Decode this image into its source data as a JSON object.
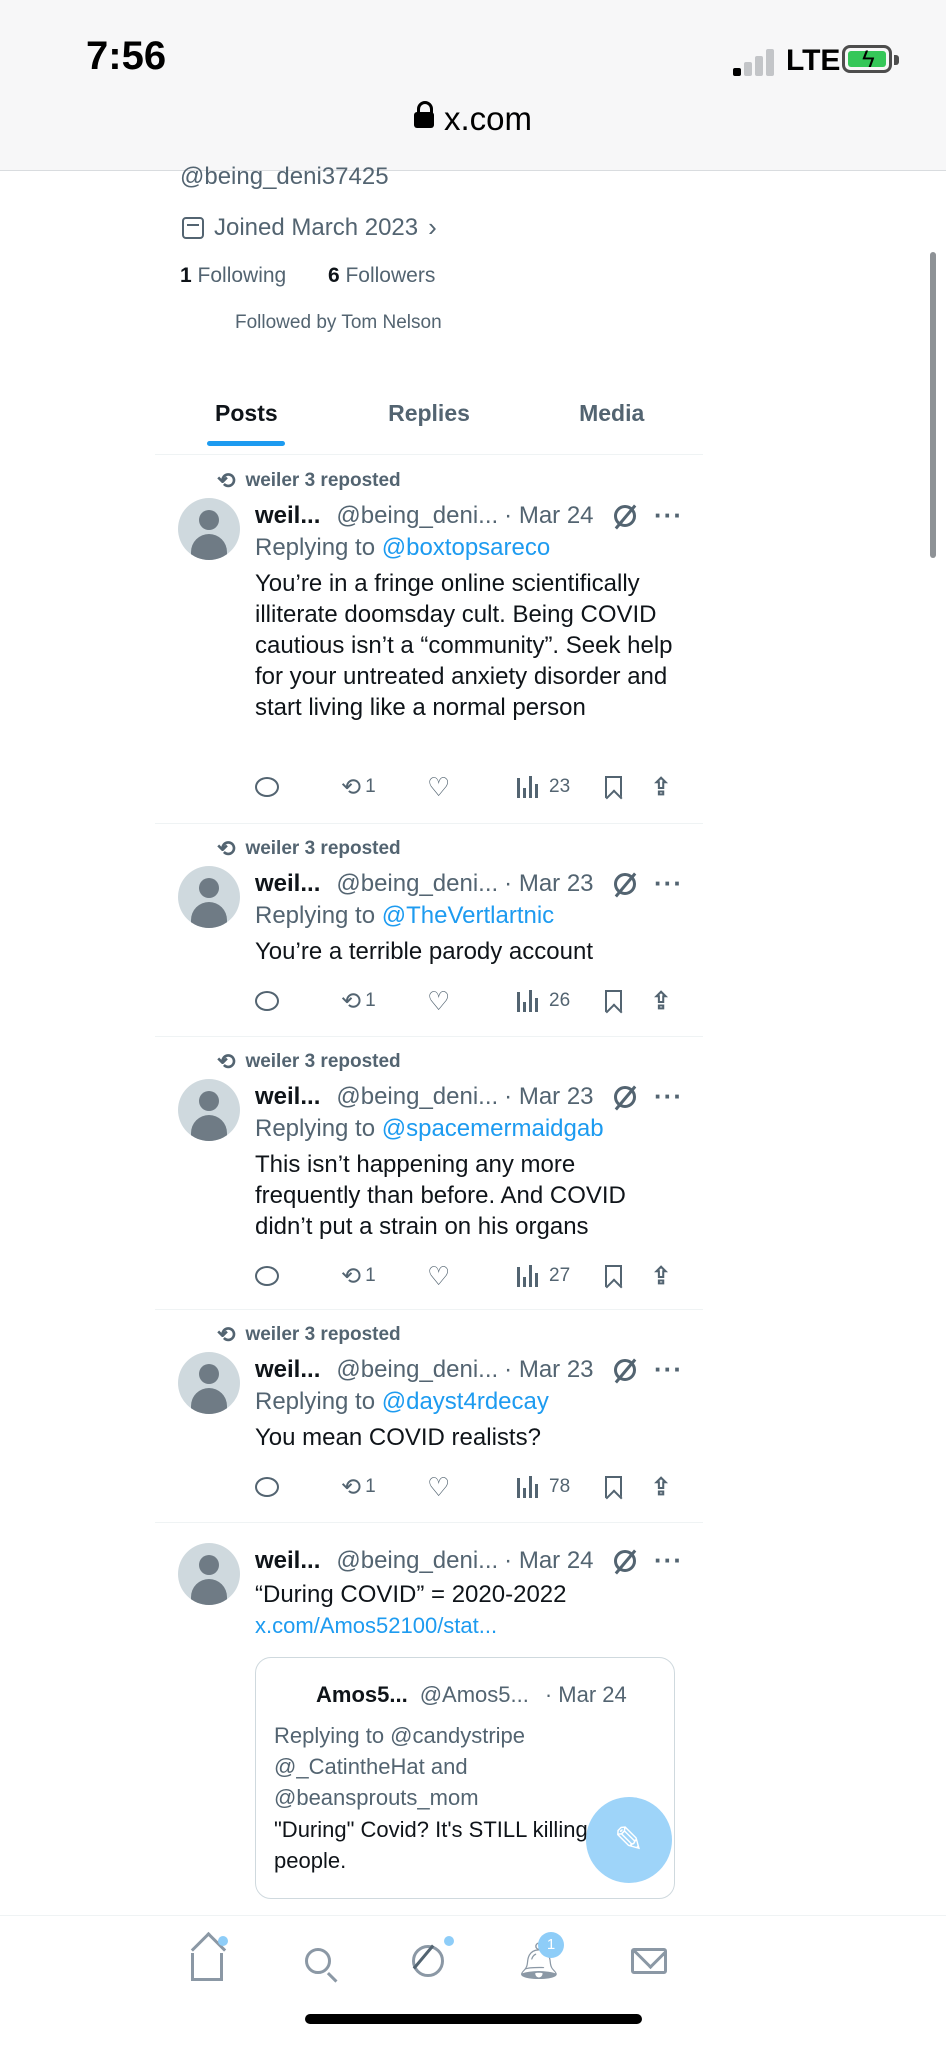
{
  "status_bar": {
    "time": "7:56",
    "network": "LTE",
    "url": "x.com"
  },
  "profile": {
    "handle": "@being_deni37425",
    "joined": "Joined March 2023",
    "following_count": "1",
    "following_label": "Following",
    "followers_count": "6",
    "followers_label": "Followers",
    "followed_by": "Followed by Tom Nelson"
  },
  "tabs": [
    {
      "label": "Posts",
      "active": true
    },
    {
      "label": "Replies",
      "active": false
    },
    {
      "label": "Media",
      "active": false
    }
  ],
  "posts": [
    {
      "repost_label": "weiler 3 reposted",
      "name": "weil...",
      "handle": "@being_deni...",
      "date": "· Mar 24",
      "replying_prefix": "Replying to",
      "replying_to": "@boxtopsareco",
      "text": "You’re in a fringe online scientifically illiterate doomsday cult. Being COVID cautious isn’t a “community”. Seek help for your untreated anxiety disorder and start living like a normal person",
      "reposts": "1",
      "views": "23"
    },
    {
      "repost_label": "weiler 3 reposted",
      "name": "weil...",
      "handle": "@being_deni...",
      "date": "· Mar 23",
      "replying_prefix": "Replying to",
      "replying_to": "@TheVertlartnic",
      "text": "You’re a terrible parody account",
      "reposts": "1",
      "views": "26"
    },
    {
      "repost_label": "weiler 3 reposted",
      "name": "weil...",
      "handle": "@being_deni...",
      "date": "· Mar 23",
      "replying_prefix": "Replying to",
      "replying_to": "@spacemermaidgab",
      "text": "This isn’t happening any more frequently than before. And COVID didn’t put a strain on his organs",
      "reposts": "1",
      "views": "27"
    },
    {
      "repost_label": "weiler 3 reposted",
      "name": "weil...",
      "handle": "@being_deni...",
      "date": "· Mar 23",
      "replying_prefix": "Replying to",
      "replying_to": "@dayst4rdecay",
      "text": "You mean COVID realists?",
      "reposts": "1",
      "views": "78"
    },
    {
      "name": "weil...",
      "handle": "@being_deni...",
      "date": "· Mar 24",
      "text": "“During COVID” = 2020-2022",
      "link": "x.com/Amos52100/stat...",
      "quote": {
        "name": "Amos5...",
        "handle": "@Amos5...",
        "date": "· Mar 24",
        "replying": "Replying to @candystripe @_CatintheHat and @beansprouts_mom",
        "text": "\"During\" Covid? It's STILL killing people."
      }
    }
  ],
  "notifications_badge": "1",
  "icons": [
    "lock-icon",
    "calendar-icon",
    "chevron-right-icon",
    "repost-icon",
    "grok-icon",
    "more-icon",
    "reply-icon",
    "like-icon",
    "views-icon",
    "bookmark-icon",
    "share-icon",
    "compose-icon",
    "home-icon",
    "search-icon",
    "notifications-icon",
    "messages-icon"
  ],
  "colors": {
    "accent": "#1d9bf0",
    "secondary_text": "#536471",
    "battery": "#35c759"
  }
}
